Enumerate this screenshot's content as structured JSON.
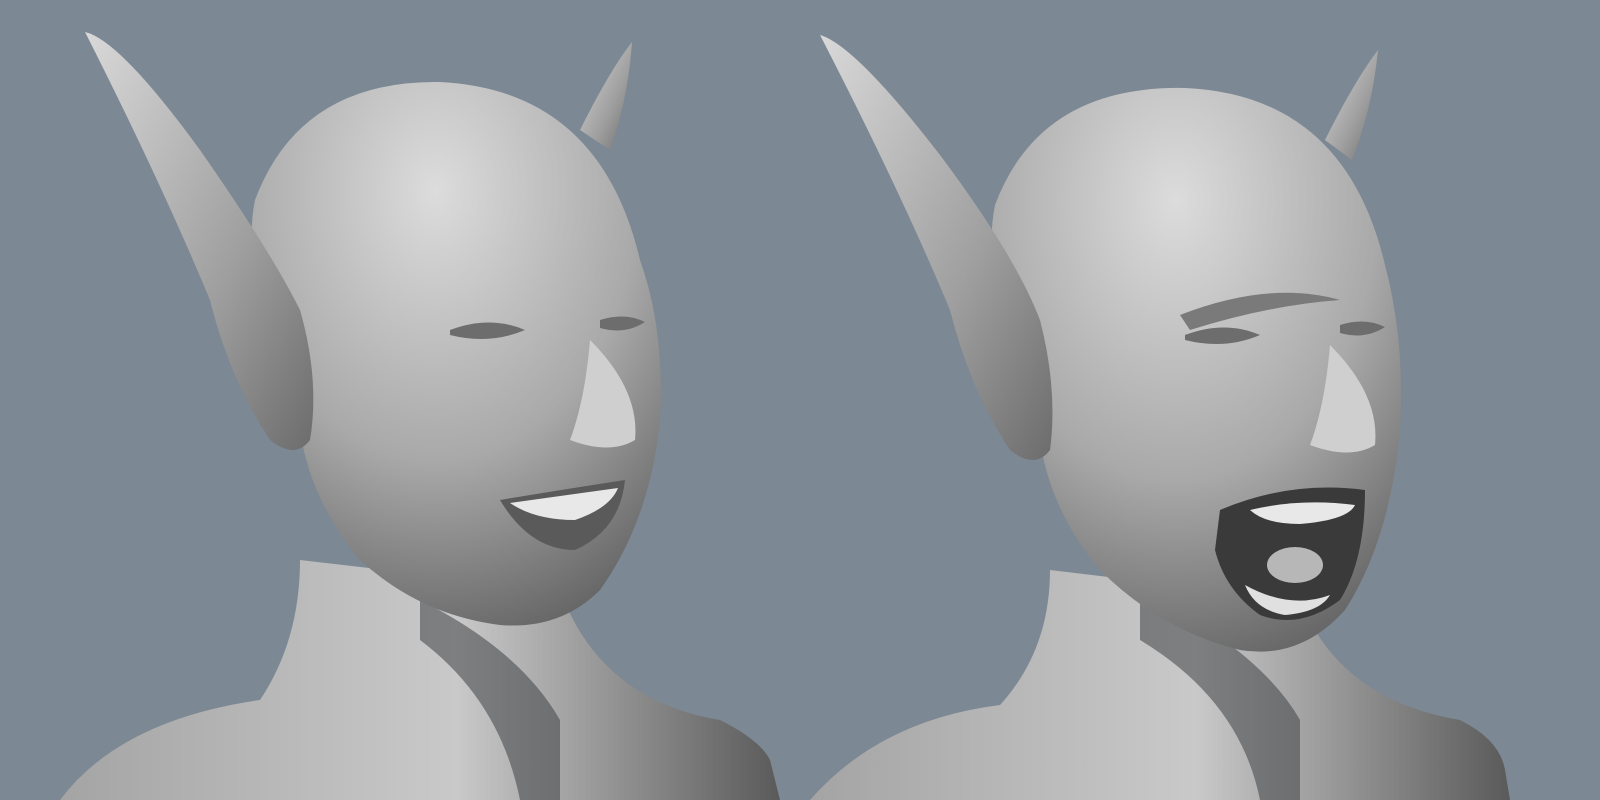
{
  "scene": {
    "background_color": "#7c8893",
    "material_color": "#bdbdbd",
    "shadow_color": "#3e4246",
    "renders": [
      {
        "expression": "smile",
        "mouth_state": "closed-grin"
      },
      {
        "expression": "scream",
        "mouth_state": "wide-open"
      }
    ]
  }
}
